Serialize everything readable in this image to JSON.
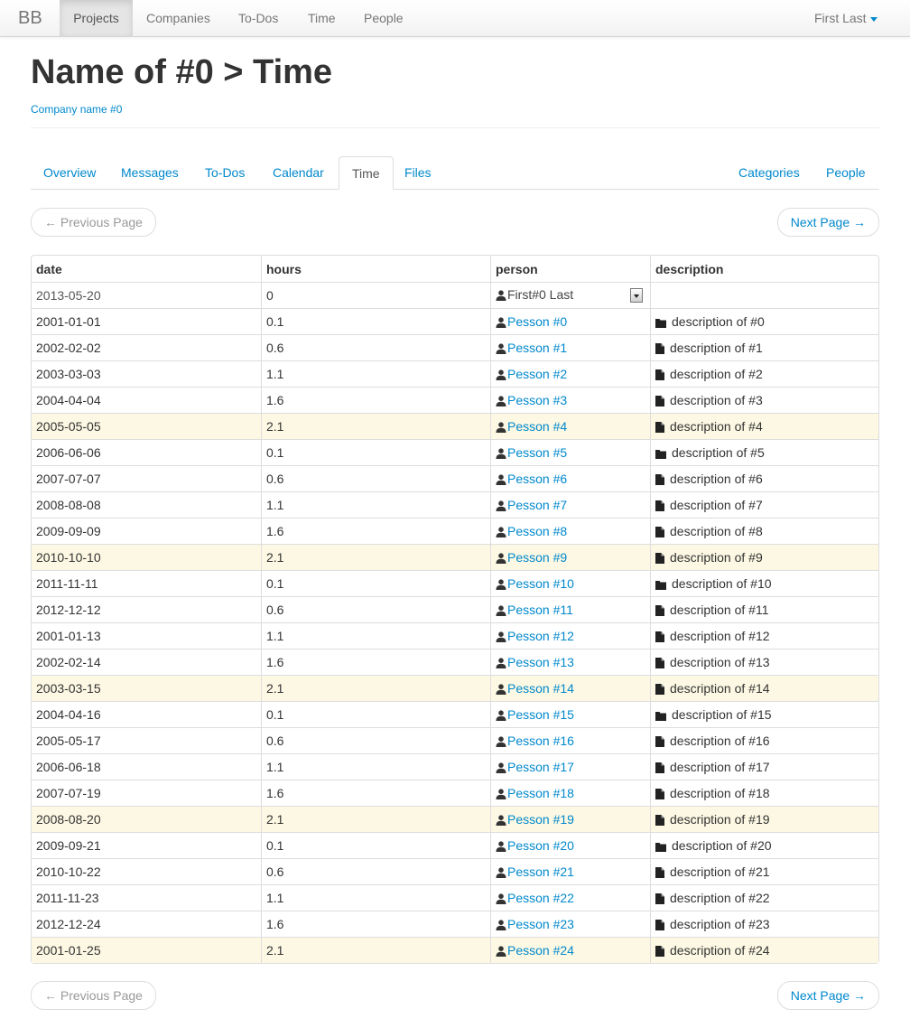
{
  "nav": {
    "brand": "BB",
    "items": [
      {
        "label": "Projects",
        "active": true
      },
      {
        "label": "Companies"
      },
      {
        "label": "To-Dos"
      },
      {
        "label": "Time"
      },
      {
        "label": "People"
      }
    ],
    "user": "First Last"
  },
  "header": {
    "title": "Name of #0 > Time",
    "company": "Company name #0"
  },
  "tabs": {
    "left": [
      "Overview",
      "Messages",
      "To-Dos",
      "Calendar",
      "Time",
      "Files"
    ],
    "right": [
      "Categories",
      "People"
    ],
    "active": "Time"
  },
  "pager": {
    "prev": "← Previous Page",
    "next": "Next Page →"
  },
  "table": {
    "columns": [
      "date",
      "hours",
      "person",
      "description"
    ],
    "new_row": {
      "date": "2013-05-20",
      "hours": "0",
      "person_selected": "First#0 Last"
    },
    "rows": [
      {
        "date": "2001-01-01",
        "hours": "0.1",
        "person": "Pesson #0",
        "description": "description of #0",
        "icon": "folder-icon",
        "highlight": false
      },
      {
        "date": "2002-02-02",
        "hours": "0.6",
        "person": "Pesson #1",
        "description": "description of #1",
        "icon": "file-icon",
        "highlight": false
      },
      {
        "date": "2003-03-03",
        "hours": "1.1",
        "person": "Pesson #2",
        "description": "description of #2",
        "icon": "file-icon",
        "highlight": false
      },
      {
        "date": "2004-04-04",
        "hours": "1.6",
        "person": "Pesson #3",
        "description": "description of #3",
        "icon": "file-icon",
        "highlight": false
      },
      {
        "date": "2005-05-05",
        "hours": "2.1",
        "person": "Pesson #4",
        "description": "description of #4",
        "icon": "file-icon",
        "highlight": true
      },
      {
        "date": "2006-06-06",
        "hours": "0.1",
        "person": "Pesson #5",
        "description": "description of #5",
        "icon": "folder-icon",
        "highlight": false
      },
      {
        "date": "2007-07-07",
        "hours": "0.6",
        "person": "Pesson #6",
        "description": "description of #6",
        "icon": "file-icon",
        "highlight": false
      },
      {
        "date": "2008-08-08",
        "hours": "1.1",
        "person": "Pesson #7",
        "description": "description of #7",
        "icon": "file-icon",
        "highlight": false
      },
      {
        "date": "2009-09-09",
        "hours": "1.6",
        "person": "Pesson #8",
        "description": "description of #8",
        "icon": "file-icon",
        "highlight": false
      },
      {
        "date": "2010-10-10",
        "hours": "2.1",
        "person": "Pesson #9",
        "description": "description of #9",
        "icon": "file-icon",
        "highlight": true
      },
      {
        "date": "2011-11-11",
        "hours": "0.1",
        "person": "Pesson #10",
        "description": "description of #10",
        "icon": "folder-icon",
        "highlight": false
      },
      {
        "date": "2012-12-12",
        "hours": "0.6",
        "person": "Pesson #11",
        "description": "description of #11",
        "icon": "file-icon",
        "highlight": false
      },
      {
        "date": "2001-01-13",
        "hours": "1.1",
        "person": "Pesson #12",
        "description": "description of #12",
        "icon": "file-icon",
        "highlight": false
      },
      {
        "date": "2002-02-14",
        "hours": "1.6",
        "person": "Pesson #13",
        "description": "description of #13",
        "icon": "file-icon",
        "highlight": false
      },
      {
        "date": "2003-03-15",
        "hours": "2.1",
        "person": "Pesson #14",
        "description": "description of #14",
        "icon": "file-icon",
        "highlight": true
      },
      {
        "date": "2004-04-16",
        "hours": "0.1",
        "person": "Pesson #15",
        "description": "description of #15",
        "icon": "folder-icon",
        "highlight": false
      },
      {
        "date": "2005-05-17",
        "hours": "0.6",
        "person": "Pesson #16",
        "description": "description of #16",
        "icon": "file-icon",
        "highlight": false
      },
      {
        "date": "2006-06-18",
        "hours": "1.1",
        "person": "Pesson #17",
        "description": "description of #17",
        "icon": "file-icon",
        "highlight": false
      },
      {
        "date": "2007-07-19",
        "hours": "1.6",
        "person": "Pesson #18",
        "description": "description of #18",
        "icon": "file-icon",
        "highlight": false
      },
      {
        "date": "2008-08-20",
        "hours": "2.1",
        "person": "Pesson #19",
        "description": "description of #19",
        "icon": "file-icon",
        "highlight": true
      },
      {
        "date": "2009-09-21",
        "hours": "0.1",
        "person": "Pesson #20",
        "description": "description of #20",
        "icon": "folder-icon",
        "highlight": false
      },
      {
        "date": "2010-10-22",
        "hours": "0.6",
        "person": "Pesson #21",
        "description": "description of #21",
        "icon": "file-icon",
        "highlight": false
      },
      {
        "date": "2011-11-23",
        "hours": "1.1",
        "person": "Pesson #22",
        "description": "description of #22",
        "icon": "file-icon",
        "highlight": false
      },
      {
        "date": "2012-12-24",
        "hours": "1.6",
        "person": "Pesson #23",
        "description": "description of #23",
        "icon": "file-icon",
        "highlight": false
      },
      {
        "date": "2001-01-25",
        "hours": "2.1",
        "person": "Pesson #24",
        "description": "description of #24",
        "icon": "file-icon",
        "highlight": true
      }
    ]
  },
  "colors": {
    "link": "#0088cc",
    "highlight_row": "#fcf8e3",
    "border": "#dddddd",
    "text": "#333333",
    "muted": "#999999"
  }
}
